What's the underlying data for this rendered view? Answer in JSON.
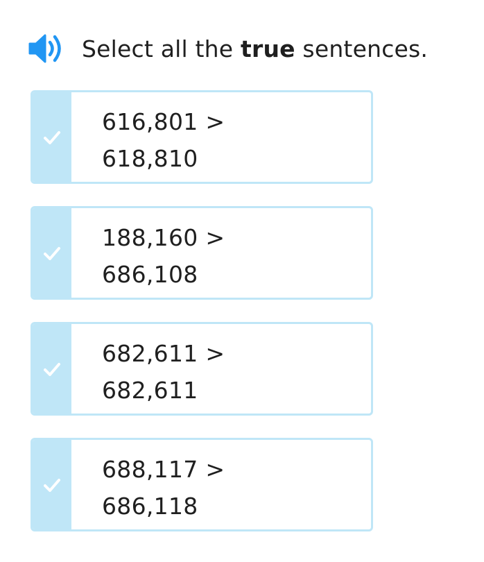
{
  "prompt": {
    "before": "Select all the ",
    "bold": "true",
    "after": " sentences."
  },
  "icons": {
    "speaker": "speaker-icon",
    "check": "checkmark-icon"
  },
  "colors": {
    "speaker_blue": "#2196f3",
    "choice_border": "#bfe6f7",
    "check_strip": "#bfe6f7"
  },
  "choices": [
    {
      "line1": "616,801 >",
      "line2": "618,810"
    },
    {
      "line1": "188,160 >",
      "line2": "686,108"
    },
    {
      "line1": "682,611 >",
      "line2": "682,611"
    },
    {
      "line1": "688,117 >",
      "line2": "686,118"
    }
  ]
}
